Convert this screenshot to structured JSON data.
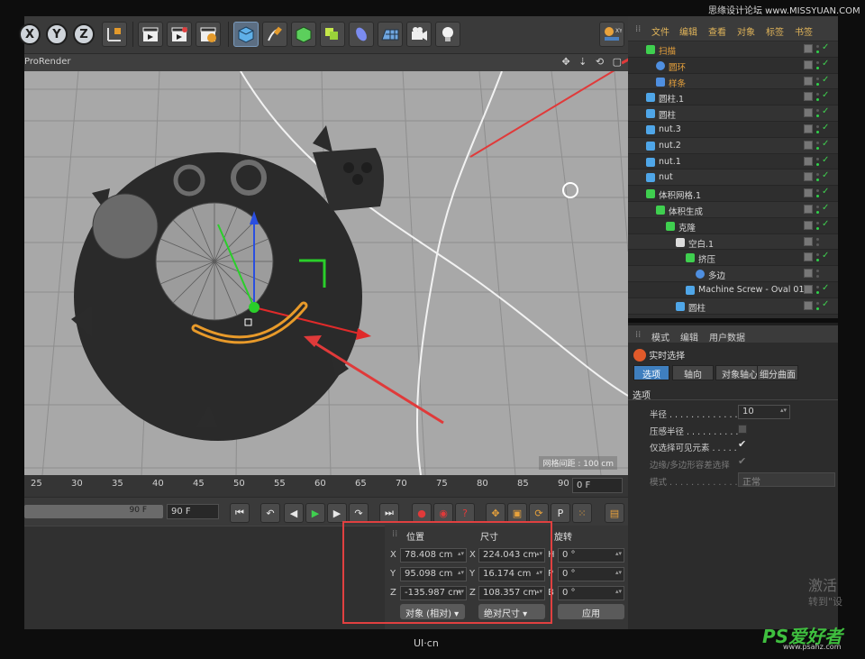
{
  "watermark": {
    "top_text": "思缘设计论坛 www.MISSYUAN.COM",
    "bottom_brand": "UI·cn",
    "ps_logo": "PS爱好者",
    "ps_sub": "www.psahz.com"
  },
  "toolbar": {
    "axis_x": "X",
    "axis_y": "Y",
    "axis_z": "Z"
  },
  "viewport": {
    "title": "ProRender",
    "nav_icons": "✥ ⇣ ⟲ ▢",
    "grid_label": "网格间距 : 100 cm"
  },
  "timeline": {
    "ticks": [
      "25",
      "30",
      "35",
      "40",
      "45",
      "50",
      "55",
      "60",
      "65",
      "70",
      "75",
      "80",
      "85",
      "90"
    ],
    "current_frame": "0 F",
    "slider_value": "90 F",
    "end_frame": "90 F"
  },
  "coords": {
    "position_header": "位置",
    "size_header": "尺寸",
    "rotation_header": "旋转",
    "rows": [
      {
        "axis": "X",
        "pos": "78.408 cm",
        "size_axis": "X",
        "size": "224.043 cm",
        "rot_axis": "H",
        "rot": "0 °"
      },
      {
        "axis": "Y",
        "pos": "95.098 cm",
        "size_axis": "Y",
        "size": "16.174 cm",
        "rot_axis": "P",
        "rot": "0 °"
      },
      {
        "axis": "Z",
        "pos": "-135.987 cm",
        "size_axis": "Z",
        "size": "108.357 cm",
        "rot_axis": "B",
        "rot": "0 °"
      }
    ],
    "mode_dropdown": "对象 (相对)",
    "size_dropdown": "绝对尺寸",
    "apply_button": "应用"
  },
  "object_manager": {
    "tabs": [
      "文件",
      "编辑",
      "查看",
      "对象",
      "标签",
      "书签"
    ],
    "objects": [
      {
        "name": "扫描",
        "indent": 0,
        "icon": "sweep-icon",
        "color": "orange",
        "dot": "g"
      },
      {
        "name": "圆环",
        "indent": 1,
        "icon": "circle-icon",
        "color": "orange",
        "dot": "g"
      },
      {
        "name": "样条",
        "indent": 1,
        "icon": "spline-icon",
        "color": "orange",
        "dot": "g"
      },
      {
        "name": "圆柱.1",
        "indent": 0,
        "icon": "cylinder-icon",
        "color": "",
        "dot": "g"
      },
      {
        "name": "圆柱",
        "indent": 0,
        "icon": "cylinder-icon",
        "color": "",
        "dot": "g"
      },
      {
        "name": "nut.3",
        "indent": 0,
        "icon": "polygon-icon",
        "color": "",
        "dot": "g"
      },
      {
        "name": "nut.2",
        "indent": 0,
        "icon": "polygon-icon",
        "color": "",
        "dot": "g"
      },
      {
        "name": "nut.1",
        "indent": 0,
        "icon": "polygon-icon",
        "color": "",
        "dot": "g"
      },
      {
        "name": "nut",
        "indent": 0,
        "icon": "polygon-icon",
        "color": "",
        "dot": "g"
      },
      {
        "name": "体积网格.1",
        "indent": 0,
        "icon": "volume-mesher-icon",
        "color": "",
        "dot": "g"
      },
      {
        "name": "体积生成",
        "indent": 1,
        "icon": "volume-builder-icon",
        "color": "",
        "dot": "g"
      },
      {
        "name": "克隆",
        "indent": 2,
        "icon": "cloner-icon",
        "color": "",
        "dot": "g"
      },
      {
        "name": "空白.1",
        "indent": 3,
        "icon": "null-icon",
        "color": "",
        "dot": ""
      },
      {
        "name": "挤压",
        "indent": 4,
        "icon": "extrude-icon",
        "color": "",
        "dot": "g"
      },
      {
        "name": "多边",
        "indent": 5,
        "icon": "polygon-circle-icon",
        "color": "",
        "dot": ""
      },
      {
        "name": "Machine Screw - Oval 01",
        "indent": 4,
        "icon": "polygon-icon",
        "color": "",
        "dot": "g"
      },
      {
        "name": "圆柱",
        "indent": 3,
        "icon": "cylinder-icon",
        "color": "",
        "dot": "g"
      }
    ]
  },
  "attributes": {
    "tabs": [
      "模式",
      "编辑",
      "用户数据"
    ],
    "mode_title": "实时选择",
    "sub_tabs": [
      "选项",
      "轴向",
      "对象轴心",
      "细分曲面"
    ],
    "section": "选项",
    "radius_label": "半径 . . . . . . . . . . . . .",
    "radius_value": "10",
    "pressure_label": "压感半径 . . . . . . . . . .",
    "visible_only_label": "仅选择可见元素 . . . . .",
    "edge_label": "边缘/多边形容差选择",
    "mode_label": "模式 . . . . . . . . . . . . .",
    "mode_value": "正常"
  },
  "system": {
    "activate_line1": "激活",
    "activate_line2": "转到\"设"
  }
}
